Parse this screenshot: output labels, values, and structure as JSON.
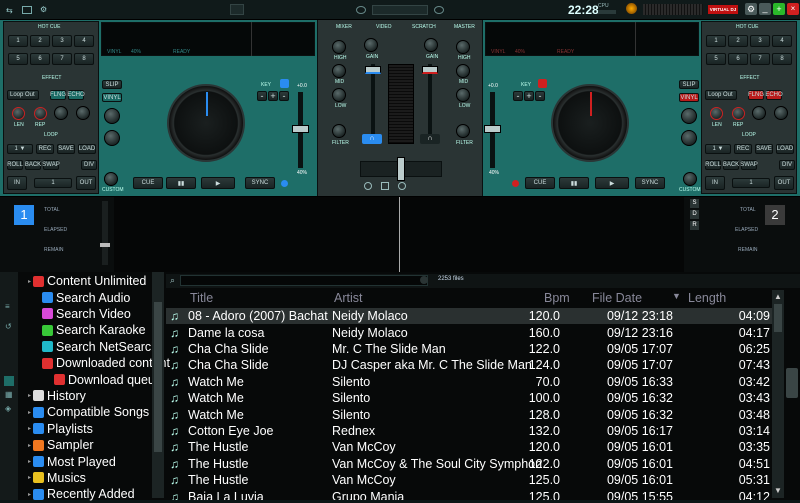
{
  "topbar": {
    "clock": "22:28",
    "cpu_label": "CPU",
    "vdj_badge": "VIRTUAL DJ"
  },
  "decks": {
    "left": {
      "number": "1",
      "hotcue": "HOT CUE",
      "hotcue_buttons": [
        "1",
        "2",
        "3",
        "4",
        "5",
        "6",
        "7",
        "8"
      ],
      "effect": "EFFECT",
      "effect_select": "Loop Out",
      "fx_buttons": [
        "FLNG",
        "ECHO"
      ],
      "knob_labels": [
        "LEN",
        "REP"
      ],
      "loop": "LOOP",
      "loop_buttons": [
        "REC",
        "SAVE",
        "LOAD",
        "ROLL",
        "BACK",
        "SWAP",
        "DIV"
      ],
      "loop_small": [
        "IN",
        "1",
        "OUT"
      ],
      "wave_label": "VINYL",
      "wave_pct": "40%",
      "wave_status": "READY",
      "slip": "SLIP",
      "vinyl": "VINYL",
      "key": "KEY",
      "pitch": "+0.0",
      "pitch_pct": "40%",
      "cue": "CUE",
      "play": "▶",
      "sync": "SYNC",
      "custom": "CUSTOM",
      "total": "TOTAL",
      "elapsed": "ELAPSED",
      "remain": "REMAIN",
      "plusminus": [
        "-",
        "+",
        "-"
      ]
    },
    "right": {
      "number": "2",
      "hotcue": "HOT CUE",
      "hotcue_buttons": [
        "1",
        "2",
        "3",
        "4",
        "5",
        "6",
        "7",
        "8"
      ],
      "effect": "EFFECT",
      "effect_select": "Loop Out",
      "fx_buttons": [
        "FLNG",
        "ECHO"
      ],
      "knob_labels": [
        "LEN",
        "REP"
      ],
      "loop": "LOOP",
      "loop_buttons": [
        "REC",
        "SAVE",
        "LOAD",
        "ROLL",
        "BACK",
        "SWAP",
        "DIV"
      ],
      "loop_small": [
        "IN",
        "1",
        "OUT"
      ],
      "wave_label": "VINYL",
      "wave_pct": "40%",
      "wave_status": "READY",
      "slip": "SLIP",
      "vinyl": "VINYL",
      "key": "KEY",
      "pitch": "+0.0",
      "pitch_pct": "40%",
      "cue": "CUE",
      "play": "▶",
      "sync": "SYNC",
      "custom": "CUSTOM",
      "total": "TOTAL",
      "elapsed": "ELAPSED",
      "remain": "REMAIN",
      "plusminus": [
        "-",
        "+",
        "-"
      ]
    }
  },
  "mixer": {
    "tabs": [
      "MIXER",
      "VIDEO",
      "SCRATCH",
      "MASTER"
    ],
    "gain": "GAIN",
    "eq": [
      "HIGH",
      "MID",
      "LOW"
    ],
    "filter": "FILTER"
  },
  "sampler_side": [
    "S",
    "D",
    "R"
  ],
  "browser": {
    "search_placeholder": "",
    "file_count": "2253 files",
    "columns": [
      "Title",
      "Artist",
      "Bpm",
      "File Date",
      "Length"
    ],
    "tree": [
      {
        "label": "Content Unlimited",
        "color": "#e03030",
        "level": 0
      },
      {
        "label": "Search Audio",
        "color": "#2a8cf0",
        "level": 1
      },
      {
        "label": "Search Video",
        "color": "#d84ad8",
        "level": 1
      },
      {
        "label": "Search Karaoke",
        "color": "#38c838",
        "level": 1
      },
      {
        "label": "Search NetSearch",
        "color": "#20b8c8",
        "level": 1
      },
      {
        "label": "Downloaded content",
        "color": "#e03030",
        "level": 1
      },
      {
        "label": "Download queue",
        "color": "#e03030",
        "level": 2
      },
      {
        "label": "History",
        "color": "#dddddd",
        "level": 0
      },
      {
        "label": "Compatible Songs",
        "color": "#2a8cf0",
        "level": 0
      },
      {
        "label": "Playlists",
        "color": "#2a8cf0",
        "level": 0
      },
      {
        "label": "Sampler",
        "color": "#f07820",
        "level": 0
      },
      {
        "label": "Most Played",
        "color": "#2a8cf0",
        "level": 0
      },
      {
        "label": "Musics",
        "color": "#e8c020",
        "level": 0
      },
      {
        "label": "Recently Added",
        "color": "#2a8cf0",
        "level": 0
      }
    ],
    "rows": [
      {
        "title": "08 - Adoro (2007) Bachata",
        "artist": "Neidy Molaco",
        "bpm": "120.0",
        "date": "09/12 23:18",
        "len": "04:09",
        "sel": true
      },
      {
        "title": "Dame la cosa",
        "artist": "Neidy Molaco",
        "bpm": "160.0",
        "date": "09/12 23:16",
        "len": "04:17"
      },
      {
        "title": "Cha Cha Slide",
        "artist": "Mr. C The Slide Man",
        "bpm": "122.0",
        "date": "09/05 17:07",
        "len": "06:25"
      },
      {
        "title": "Cha Cha Slide",
        "artist": "DJ Casper aka Mr. C The Slide Man",
        "bpm": "124.0",
        "date": "09/05 17:07",
        "len": "07:43"
      },
      {
        "title": "Watch Me",
        "artist": "Silento",
        "bpm": "70.0",
        "date": "09/05 16:33",
        "len": "03:42"
      },
      {
        "title": "Watch Me",
        "artist": "Silento",
        "bpm": "100.0",
        "date": "09/05 16:32",
        "len": "03:43"
      },
      {
        "title": "Watch Me",
        "artist": "Silento",
        "bpm": "128.0",
        "date": "09/05 16:32",
        "len": "03:48"
      },
      {
        "title": "Cotton Eye Joe",
        "artist": "Rednex",
        "bpm": "132.0",
        "date": "09/05 16:17",
        "len": "03:14"
      },
      {
        "title": "The Hustle",
        "artist": "Van McCoy",
        "bpm": "120.0",
        "date": "09/05 16:01",
        "len": "03:35"
      },
      {
        "title": "The Hustle",
        "artist": "Van McCoy & The Soul City Symphony",
        "bpm": "122.0",
        "date": "09/05 16:01",
        "len": "04:51"
      },
      {
        "title": "The Hustle",
        "artist": "Van McCoy",
        "bpm": "125.0",
        "date": "09/05 16:01",
        "len": "05:31"
      },
      {
        "title": "Baja La Luvia",
        "artist": "Grupo Mania",
        "bpm": "125.0",
        "date": "09/05 15:55",
        "len": "04:12"
      }
    ]
  }
}
